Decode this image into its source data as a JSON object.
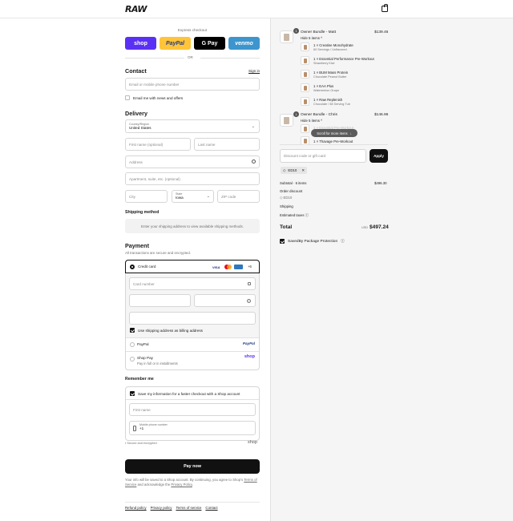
{
  "header": {
    "logo": "RAW",
    "cart_icon": "bag-icon"
  },
  "express": {
    "title": "Express checkout",
    "buttons": [
      {
        "label": "shop",
        "bg": "#5a31f4",
        "color": "#ffffff"
      },
      {
        "label": "PayPal",
        "bg": "#ffc439",
        "color": "#253b80"
      },
      {
        "label": "G Pay",
        "bg": "#000000",
        "color": "#ffffff"
      },
      {
        "label": "venmo",
        "bg": "#3d95ce",
        "color": "#ffffff"
      }
    ],
    "or": "OR"
  },
  "contact": {
    "title": "Contact",
    "signin": "Sign in",
    "email_placeholder": "Email or mobile phone number",
    "news_label": "Email me with news and offers"
  },
  "delivery": {
    "title": "Delivery",
    "country_label": "Country/Region",
    "country_value": "United States",
    "first_name": "First name (optional)",
    "last_name": "Last name",
    "address": "Address",
    "apartment": "Apartment, suite, etc. (optional)",
    "city": "City",
    "state_label": "State",
    "state_value": "Iowa",
    "zip": "ZIP code"
  },
  "shipping": {
    "title": "Shipping method",
    "message": "Enter your shipping address to view available shipping methods."
  },
  "payment": {
    "title": "Payment",
    "subtitle": "All transactions are secure and encrypted.",
    "credit_card": "Credit card",
    "card_more": "+6",
    "card_number": "Card number",
    "billing_label": "Use shipping address as billing address",
    "paypal": "PayPal",
    "paypal_logo": "PayPal",
    "shoppay": "Shop Pay",
    "shoppay_sub": "Pay in full or in installments",
    "shoppay_logo": "shop"
  },
  "remember": {
    "title": "Remember me",
    "save_label": "Save my information for a faster checkout with a Shop account",
    "first_name": "First name",
    "phone_label": "Mobile phone number",
    "phone_value": "+1",
    "secure": "Secure and encrypted",
    "shop_logo": "shop"
  },
  "pay": {
    "label": "Pay now",
    "notice_prefix": "Your info will be saved to a Shop account. By continuing, you agree to Shop's",
    "terms": "Terms of Service",
    "and": "and acknowledge the",
    "privacy": "Privacy Policy",
    "period": "."
  },
  "footer": {
    "links": [
      "Refund policy",
      "Privacy policy",
      "Terms of service",
      "Contact"
    ]
  },
  "summary": {
    "bundles": [
      {
        "qty": "1",
        "name": "Owner Bundle - Matt",
        "price": "$139.46",
        "toggle": "Hide 5 items",
        "items": [
          {
            "name": "1 × Creatine Monohydrate",
            "variant": "60 Servings / Unflavored"
          },
          {
            "name": "1 × Essential Performance Pre-Workout",
            "variant": "Strawberry Kiwi"
          },
          {
            "name": "1 × BUM Mass Protein",
            "variant": "Chocolate Peanut Butter"
          },
          {
            "name": "1 × EAA Plus",
            "variant": "Watermelon Grape"
          },
          {
            "name": "1 × Raw Replenish",
            "variant": "Chocolate / 58 Serving Tub"
          }
        ]
      },
      {
        "qty": "1",
        "name": "Owner Bundle - Chris",
        "price": "$146.96",
        "toggle": "Hide 5 items",
        "items": [
          {
            "name": "1 × Essential Pre-Workout",
            "variant": ""
          },
          {
            "name": "1 × Thavage Pre-Workout",
            "variant": ""
          }
        ]
      }
    ],
    "scroll_hint": "Scroll for more items",
    "discount_placeholder": "Discount code or gift card",
    "apply": "Apply",
    "code": "ED10",
    "subtotal_label": "Subtotal · 6 items",
    "subtotal_value": "$496.30",
    "order_discount": "Order discount",
    "discount_code": "ED10",
    "shipping": "Shipping",
    "taxes": "Estimated taxes",
    "total_label": "Total",
    "currency": "USD",
    "total_value": "$497.24",
    "protection": "SavedBy Package Protection"
  }
}
